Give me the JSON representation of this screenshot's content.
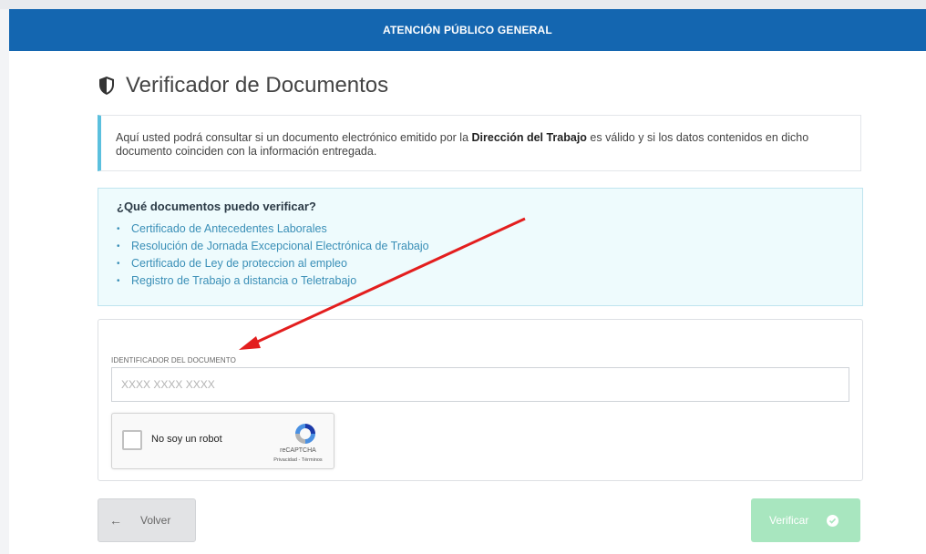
{
  "header": {
    "title": "ATENCIÓN PÚBLICO GENERAL"
  },
  "page": {
    "title": "Verificador de Documentos"
  },
  "intro": {
    "part1": "Aquí usted podrá consultar si un documento electrónico emitido por la ",
    "bold": "Dirección del Trabajo",
    "part2": " es válido y si los datos contenidos en dicho documento coinciden con la información entregada."
  },
  "docs": {
    "heading": "¿Qué documentos puedo verificar?",
    "items": [
      "Certificado de Antecedentes Laborales",
      "Resolución de Jornada Excepcional Electrónica de Trabajo",
      "Certificado de Ley de proteccion al empleo",
      "Registro de Trabajo a distancia o Teletrabajo"
    ]
  },
  "form": {
    "label": "IDENTIFICADOR DEL DOCUMENTO",
    "placeholder": "XXXX XXXX XXXX",
    "value": ""
  },
  "recaptcha": {
    "label": "No soy un robot",
    "brand": "reCAPTCHA",
    "privacy": "Privacidad - Términos"
  },
  "buttons": {
    "back": "Volver",
    "verify": "Verificar"
  },
  "colors": {
    "header_bg": "#1466b0",
    "info_border": "#5bc0de",
    "docs_bg": "#eefbfd",
    "link": "#3a8fb7",
    "verify_bg": "#a8e6bf",
    "annotation_arrow": "#e31e1e"
  },
  "icons": {
    "title": "shield-icon",
    "back": "arrow-left-icon",
    "verify": "check-circle-icon",
    "recaptcha": "recaptcha-logo-icon"
  }
}
